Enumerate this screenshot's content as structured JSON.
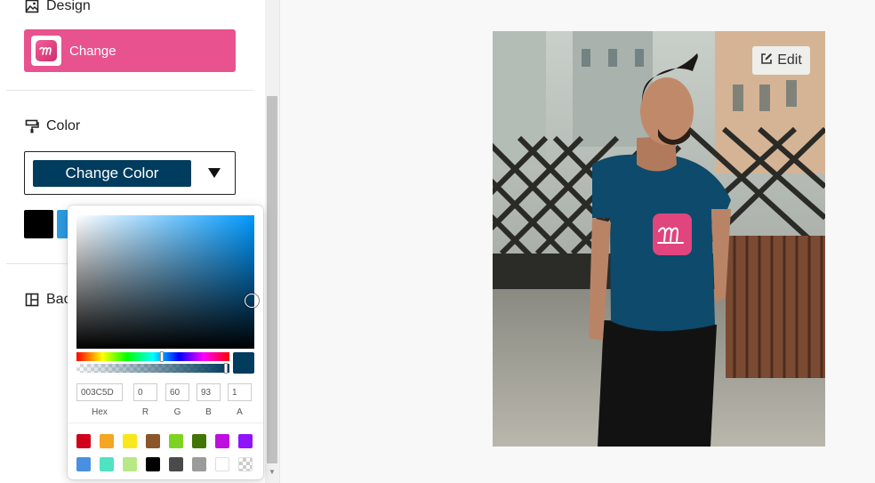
{
  "sidebar": {
    "design_title": "Design",
    "change_label": "Change",
    "color_title": "Color",
    "change_color_label": "Change Color",
    "background_title": "Bac",
    "swatches": [
      "#000000",
      "#2d9be0"
    ]
  },
  "picker": {
    "hex": "003C5D",
    "r": "0",
    "g": "60",
    "b": "93",
    "a": "1",
    "labels": {
      "hex": "Hex",
      "r": "R",
      "g": "G",
      "b": "B",
      "a": "A"
    },
    "current_color": "#003c5d",
    "presets": [
      "#d0021b",
      "#f5a623",
      "#f8e71c",
      "#8b572a",
      "#7ed321",
      "#417505",
      "#bd10e0",
      "#9013fe",
      "#4a90e2",
      "#50e3c2",
      "#b8e986",
      "#000000",
      "#4a4a4a",
      "#9b9b9b",
      "#ffffff",
      "transparent"
    ]
  },
  "canvas": {
    "edit_label": "Edit",
    "tshirt_color": "#0d4a6b",
    "logo_color": "#e0457e"
  }
}
